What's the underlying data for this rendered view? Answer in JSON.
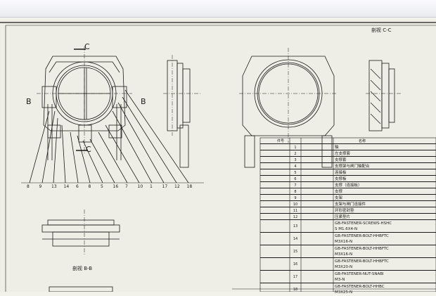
{
  "section_labels": {
    "cc": "剖视 C-C",
    "bb": "剖视 B-B",
    "c_top": "C",
    "c_bottom": "C",
    "b_left": "B",
    "b_right": "B"
  },
  "balloons": [
    "8",
    "9",
    "13",
    "14",
    "6",
    "8",
    "5",
    "16",
    "7",
    "10",
    "1",
    "17",
    "12",
    "18"
  ],
  "bom": {
    "header_left": "件号",
    "header_right": "名称",
    "rows": [
      {
        "no": "1",
        "text": "轴"
      },
      {
        "no": "2",
        "text": "左支撑套"
      },
      {
        "no": "3",
        "text": "支撑套"
      },
      {
        "no": "4",
        "text": "支撑架与闸门轴配合"
      },
      {
        "no": "5",
        "text": "连接板"
      },
      {
        "no": "6",
        "text": "支撑板"
      },
      {
        "no": "7",
        "text": "支撑（连接板）"
      },
      {
        "no": "8",
        "text": "支撑"
      },
      {
        "no": "9",
        "text": "支架"
      },
      {
        "no": "10",
        "text": "支架与闸门连接件"
      },
      {
        "no": "11",
        "text": "环形密封垫"
      },
      {
        "no": "12",
        "text": "压紧垫片"
      },
      {
        "no": "13",
        "text": "GB-FASTENER-SCREWS-HSHC\nS M1.6X4-N"
      },
      {
        "no": "14",
        "text": "GB-FASTENER-BOLT-HHBFTC\nM3X16-N"
      },
      {
        "no": "15",
        "text": "GB-FASTENER-BOLT-HHBFTC\nM3X16-N"
      },
      {
        "no": "16",
        "text": "GB-FASTENER-BOLT-HHBFTC\nM3X20-N"
      },
      {
        "no": "17",
        "text": "GB-FASTENER-NUT-SNABI\nM3-N"
      },
      {
        "no": "18",
        "text": "GB-FASTENER-BOLT-HHBC\nM3X25-N"
      }
    ]
  }
}
